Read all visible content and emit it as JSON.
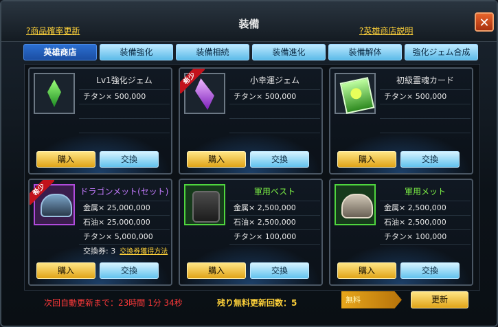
{
  "title": "装備",
  "links": {
    "left": "?商品確率更新",
    "right": "?英雄商店説明"
  },
  "tabs": [
    "英雄商店",
    "装備強化",
    "装備相続",
    "装備進化",
    "装備解体",
    "強化ジェム合成"
  ],
  "rare_label": "希少",
  "buy_label": "購入",
  "exchange_label": "交換",
  "items": [
    {
      "name": "Lv1強化ジェム",
      "costs": [
        "チタン× 500,000"
      ],
      "icon": "green-gem-icon"
    },
    {
      "name": "小幸運ジェム",
      "costs": [
        "チタン× 500,000"
      ],
      "icon": "purple-gem-icon",
      "rare": true
    },
    {
      "name": "初級霊魂カード",
      "costs": [
        "チタン× 500,000"
      ],
      "icon": "soul-card-icon"
    },
    {
      "name": "ドラゴンメット(セット)",
      "costs": [
        "金属× 25,000,000",
        "石油× 25,000,000",
        "チタン× 5,000,000"
      ],
      "ticket": "交換券: 3",
      "ticket_link": "交換券獲得方法",
      "icon": "dragon-helmet-icon",
      "rare": true
    },
    {
      "name": "軍用ベスト",
      "costs": [
        "金属× 2,500,000",
        "石油× 2,500,000",
        "チタン× 100,000"
      ],
      "icon": "military-vest-icon"
    },
    {
      "name": "軍用メット",
      "costs": [
        "金属× 2,500,000",
        "石油× 2,500,000",
        "チタン× 100,000"
      ],
      "icon": "military-helmet-icon"
    }
  ],
  "footer": {
    "timer": "次回自動更新まで：23時間 1分 34秒",
    "remaining": "残り無料更新回数：5",
    "free": "無料",
    "refresh": "更新"
  }
}
